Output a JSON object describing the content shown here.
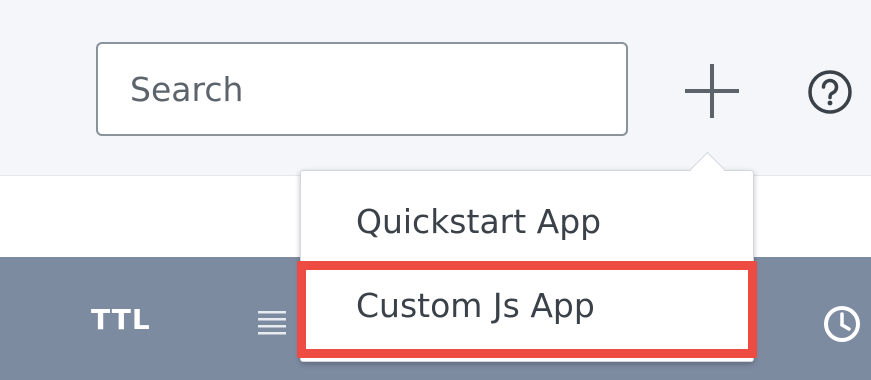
{
  "header": {
    "search": {
      "placeholder": "Search",
      "value": ""
    },
    "add_icon": "plus-icon",
    "help_icon": "help-circle-icon"
  },
  "toolbar": {
    "ttl_label": "TTL",
    "list_icon": "list-icon",
    "clock_icon": "clock-icon",
    "background_color": "#7d8ba1"
  },
  "dropdown": {
    "items": [
      {
        "label": "Quickstart App"
      },
      {
        "label": "Custom Js App"
      }
    ],
    "highlighted_item": "Custom Js App",
    "highlight_color": "#ee4b43"
  }
}
